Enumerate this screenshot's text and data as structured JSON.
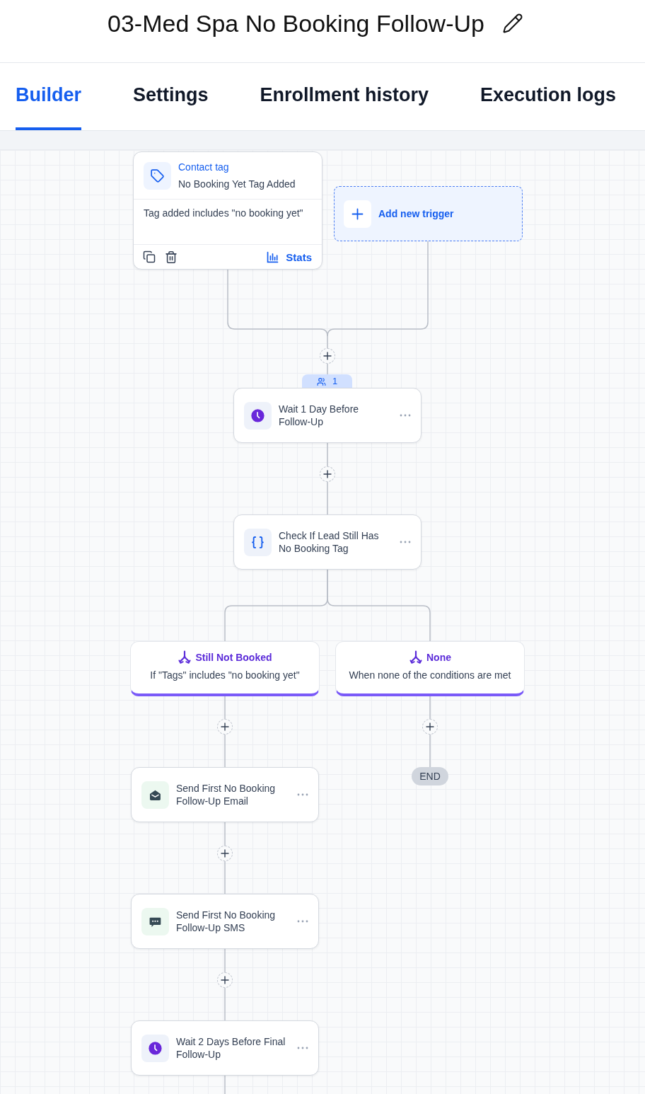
{
  "header": {
    "title": "03-Med Spa No Booking Follow-Up"
  },
  "tabs": [
    {
      "label": "Builder",
      "selected": true
    },
    {
      "label": "Settings",
      "selected": false
    },
    {
      "label": "Enrollment history",
      "selected": false
    },
    {
      "label": "Execution logs",
      "selected": false
    }
  ],
  "canvas": {
    "triggers": [
      {
        "kind": "contact_tag",
        "type_label": "Contact tag",
        "name": "No Booking Yet Tag Added",
        "condition": "Tag added includes \"no booking yet\"",
        "stats_label": "Stats"
      }
    ],
    "add_trigger": {
      "label": "Add new trigger"
    },
    "steps": [
      {
        "kind": "wait",
        "title": "Wait 1 Day Before Follow-Up",
        "enrolled": "1"
      },
      {
        "kind": "condition",
        "title": "Check If Lead Still Has No Booking Tag"
      }
    ],
    "branches": [
      {
        "name": "Still Not Booked",
        "description": "If \"Tags\" includes \"no booking yet\"",
        "steps": [
          {
            "kind": "email",
            "title": "Send First No Booking Follow-Up Email"
          },
          {
            "kind": "sms",
            "title": "Send First No Booking Follow-Up SMS"
          },
          {
            "kind": "wait",
            "title": "Wait 2 Days Before Final Follow-Up"
          }
        ]
      },
      {
        "name": "None",
        "description": "When none of the conditions are met",
        "end_label": "END"
      }
    ]
  }
}
